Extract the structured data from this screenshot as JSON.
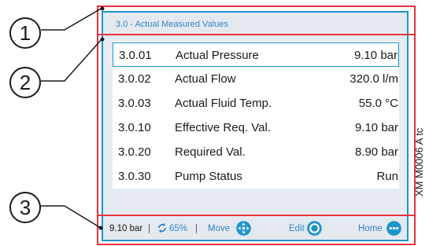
{
  "screen": {
    "header_title": "3.0 - Actual Measured Values",
    "rows": [
      {
        "code": "3.0.01",
        "label": "Actual Pressure",
        "value": "9.10 bar",
        "selected": true
      },
      {
        "code": "3.0.02",
        "label": "Actual Flow",
        "value": "320.0 l/m",
        "selected": false
      },
      {
        "code": "3.0.03",
        "label": "Actual Fluid Temp.",
        "value": "55.0 °C",
        "selected": false
      },
      {
        "code": "3.0.10",
        "label": "Effective Req. Val.",
        "value": "9.10 bar",
        "selected": false
      },
      {
        "code": "3.0.20",
        "label": "Required Val.",
        "value": "8.90 bar",
        "selected": false
      },
      {
        "code": "3.0.30",
        "label": "Pump Status",
        "value": "Run",
        "selected": false
      }
    ],
    "footer": {
      "pressure": "9.10 bar",
      "separator": "|",
      "speed": "65%",
      "move_label": "Move",
      "edit_label": "Edit",
      "home_label": "Home",
      "speed_icon": "refresh-cycle-icon",
      "move_icon": "move-arrows-icon",
      "edit_icon": "rotary-knob-icon",
      "home_icon": "more-dots-icon"
    }
  },
  "callouts": [
    "1",
    "2",
    "3"
  ],
  "figure_id": "XM M0006 A tc",
  "colors": {
    "annotation_red": "#e8343f",
    "display_blue": "#1e95cc",
    "accent_text": "#3a86c6",
    "header_bg": "#e3e9ef"
  }
}
